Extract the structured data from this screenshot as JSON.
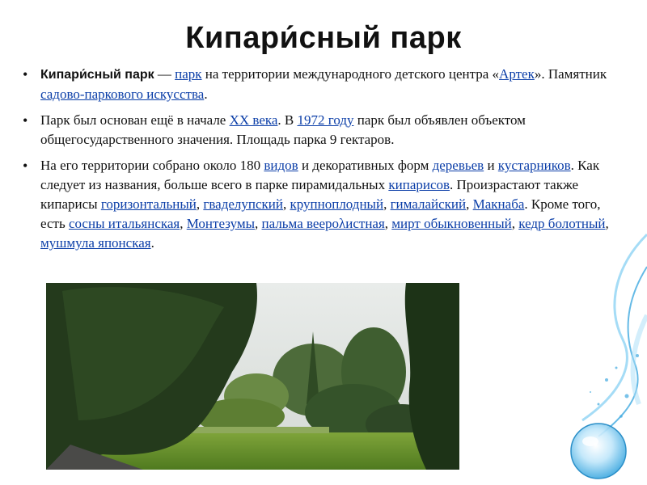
{
  "slide": {
    "title": "Кипари́сный парк",
    "bullets": [
      {
        "parts": [
          {
            "b": "Кипари́сный парк"
          },
          {
            "t": " — "
          },
          {
            "a": "парк"
          },
          {
            "t": " на территории международного детского центра «"
          },
          {
            "a": "Артек"
          },
          {
            "t": "». Памятник "
          },
          {
            "a": "садово-паркового искусства"
          },
          {
            "t": "."
          }
        ]
      },
      {
        "parts": [
          {
            "t": "Парк был основан ещё в начале "
          },
          {
            "a": "XX века"
          },
          {
            "t": ". В "
          },
          {
            "a": "1972 году"
          },
          {
            "t": " парк был объявлен объектом общегосударственного значения. Площадь парка 9 гектаров."
          }
        ]
      },
      {
        "parts": [
          {
            "t": "На его территории собрано около 180 "
          },
          {
            "a": "видов"
          },
          {
            "t": " и декоративных форм "
          },
          {
            "a": "деревьев"
          },
          {
            "t": " и "
          },
          {
            "a": "кустарников"
          },
          {
            "t": ". Как следует из названия, больше всего в парке пирамидальных "
          },
          {
            "a": "кипарисов"
          },
          {
            "t": ". Произрастают также кипарисы "
          },
          {
            "a": "горизонтальный"
          },
          {
            "t": ", "
          },
          {
            "a": "гваделупский"
          },
          {
            "t": ", "
          },
          {
            "a": "крупноплодный"
          },
          {
            "t": ", "
          },
          {
            "a": "гималайский"
          },
          {
            "t": ", "
          },
          {
            "a": "Макнаба"
          },
          {
            "t": ". Кроме того, есть "
          },
          {
            "a": "сосны итальянская"
          },
          {
            "t": ", "
          },
          {
            "a": "Монтезумы"
          },
          {
            "t": ", "
          },
          {
            "a": "пальма веерολистная"
          },
          {
            "t": ", "
          },
          {
            "a": "мирт обыкновенный"
          },
          {
            "t": ", "
          },
          {
            "a": "кедр болотный"
          },
          {
            "t": ", "
          },
          {
            "a": "мушмула японская"
          },
          {
            "t": "."
          }
        ]
      }
    ],
    "colors": {
      "link": "#0b3ea8",
      "text": "#111111",
      "decoration": "#3fa9e0"
    },
    "image": {
      "subject": "park-photo"
    },
    "decoration": {
      "subject": "blue-swirl-decoration"
    }
  }
}
